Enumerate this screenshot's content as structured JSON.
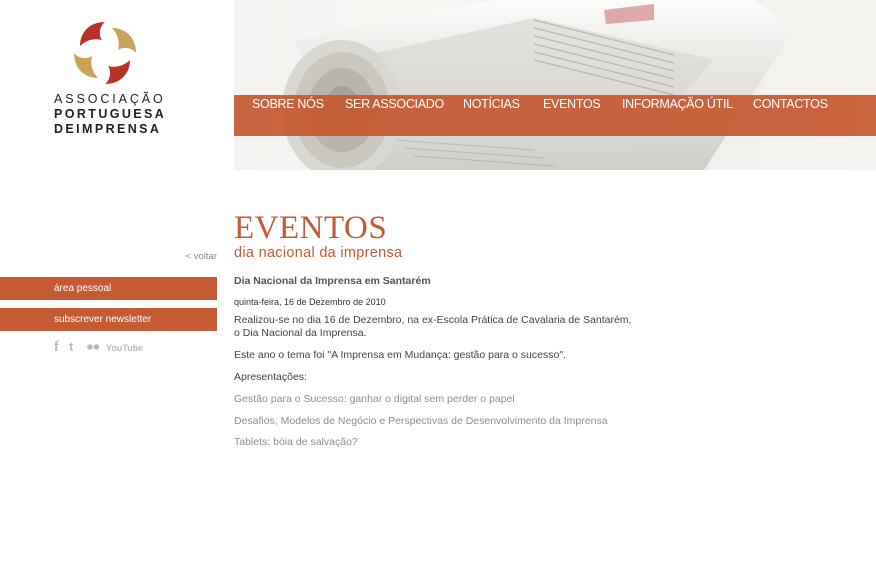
{
  "logo": {
    "line1": "ASSOCIAÇÃO",
    "line2": "PORTUGUESA",
    "line3": "DEIMPRENSA",
    "colors": {
      "red": "#c0392b",
      "gold": "#c9a35a"
    }
  },
  "nav": {
    "items": [
      "SOBRE NÓS",
      "SER ASSOCIADO",
      "NOTÍCIAS",
      "EVENTOS",
      "INFORMAÇÃO ÚTIL",
      "CONTACTOS"
    ],
    "color": "#c45830"
  },
  "sidebar": {
    "back_label": "< voltar",
    "area_pessoal": "área pessoal",
    "newsletter": "subscrever newsletter",
    "social": [
      "facebook-icon",
      "twitter-icon",
      "flickr-icon",
      "youtube-icon"
    ],
    "youtube_text": "YouTube"
  },
  "page": {
    "title": "EVENTOS",
    "subtitle": "dia nacional da imprensa",
    "accent": "#c55a34"
  },
  "article": {
    "title": "Dia Nacional da Imprensa em Santarém",
    "date": "quinta-feira, 16 de Dezembro de 2010",
    "p1": "Realizou-se no dia 16 de Dezembro, na ex-Escola Prática de Cavalaria de Santarém, o Dia Nacional da Imprensa.",
    "p2": "Este ano o tema foi \"A Imprensa em Mudança: gestão para o sucesso\".",
    "p3": "Apresentações:",
    "links": [
      "Gestão para o Sucesso: ganhar o digital sem perder o papel",
      "Desafios, Modelos de Negócio e Perspectivas de Desenvolvimento da Imprensa",
      "Tablets: bóia de salvação?"
    ]
  }
}
